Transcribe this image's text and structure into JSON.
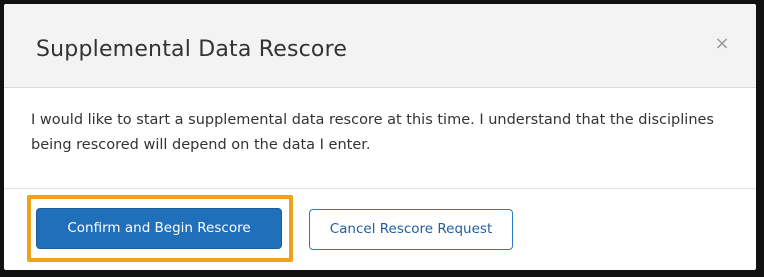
{
  "dialog": {
    "title": "Supplemental Data Rescore",
    "close_glyph": "×",
    "body_text": "I would like to start a supplemental data rescore at this time. I understand that the disciplines being rescored will depend on the data I enter.",
    "confirm_label": "Confirm and Begin Rescore",
    "cancel_label": "Cancel Rescore Request"
  },
  "colors": {
    "primary_button": "#1f6fba",
    "secondary_button_border": "#2a7bc4",
    "highlight_border": "#f0a21b",
    "header_background": "#f3f3f3"
  },
  "icons": {
    "close": "close-icon"
  }
}
